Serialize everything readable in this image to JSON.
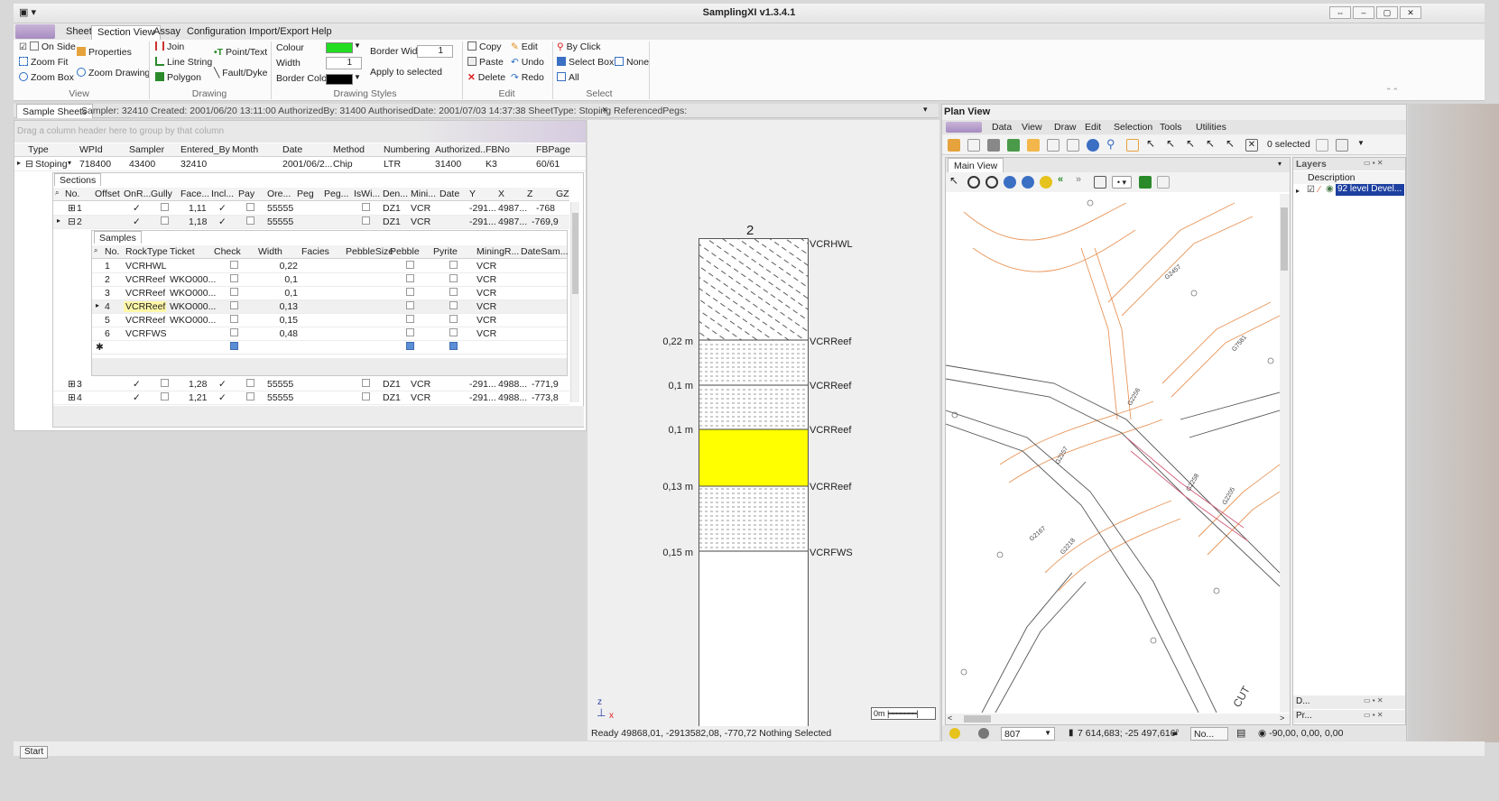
{
  "app": {
    "title": "SamplingXI v1.3.4.1",
    "quick_access": "▾"
  },
  "ribbon": {
    "tabs": [
      "Sheet",
      "Section View",
      "Assay",
      "Configuration",
      "Import/Export",
      "Help"
    ],
    "active_tab": "Section View",
    "view": {
      "group": "View",
      "on_side": "On Side",
      "zoom_fit": "Zoom Fit",
      "zoom_box": "Zoom Box",
      "properties": "Properties",
      "zoom_drawing": "Zoom Drawing"
    },
    "drawing": {
      "group": "Drawing",
      "join": "Join",
      "line_string": "Line String",
      "polygon": "Polygon",
      "point_text": "Point/Text",
      "fault_dyke": "Fault/Dyke"
    },
    "drawing_styles": {
      "group": "Drawing Styles",
      "colour_label": "Colour",
      "width_label": "Width",
      "width_value": "1",
      "border_colour_label": "Border Colour",
      "border_width_label": "Border Width",
      "border_width_value": "1",
      "apply": "Apply to selected",
      "colour_hex": "#22dd22",
      "border_colour_hex": "#000000"
    },
    "edit": {
      "group": "Edit",
      "copy": "Copy",
      "paste": "Paste",
      "delete": "Delete",
      "edit": "Edit",
      "undo": "Undo",
      "redo": "Redo"
    },
    "select": {
      "group": "Select",
      "by_click": "By Click",
      "select_box": "Select Box",
      "all": "All",
      "none": "None"
    }
  },
  "doc_tab": {
    "label": "Sample Sheets",
    "info": "Sampler: 32410 Created: 2001/06/20 13:11:00 AuthorizedBy: 31400 AuthorisedDate: 2001/07/03 14:37:38 SheetType: Stoping ReferencedPegs:",
    "close": "×"
  },
  "grid": {
    "group_hint": "Drag a column header here to group by that column",
    "columns": [
      "Type",
      "WPId",
      "Sampler",
      "Entered_By",
      "Month",
      "Date",
      "Method",
      "Numbering",
      "Authorized...",
      "FBNo",
      "FBPage"
    ],
    "row": [
      "Stoping",
      "718400",
      "43400",
      "32410",
      "",
      "2001/06/2...",
      "Chip",
      "LTR",
      "31400",
      "K3",
      "60/61"
    ],
    "sections": {
      "tab": "Sections",
      "columns": [
        "No.",
        "Offset",
        "OnR...",
        "Gully",
        "Face...",
        "Incl...",
        "Pay",
        "Ore...",
        "Peg",
        "Peg...",
        "IsWi...",
        "Den...",
        "Mini...",
        "Date",
        "Y",
        "X",
        "Z",
        "GZ"
      ],
      "rows": [
        {
          "no": "1",
          "face": "1,11",
          "ore": "55555",
          "den": "DZ1",
          "mini": "VCR",
          "y": "-291...",
          "x": "4987...",
          "z": "-768"
        },
        {
          "no": "2",
          "face": "1,18",
          "ore": "55555",
          "den": "DZ1",
          "mini": "VCR",
          "y": "-291...",
          "x": "4987...",
          "z": "-769,9"
        },
        {
          "no": "3",
          "face": "1,28",
          "ore": "55555",
          "den": "DZ1",
          "mini": "VCR",
          "y": "-291...",
          "x": "4988...",
          "z": "-771,9"
        },
        {
          "no": "4",
          "face": "1,21",
          "ore": "55555",
          "den": "DZ1",
          "mini": "VCR",
          "y": "-291...",
          "x": "4988...",
          "z": "-773,8"
        }
      ]
    },
    "samples": {
      "tab": "Samples",
      "columns": [
        "No.",
        "RockType",
        "Ticket",
        "Check",
        "Width",
        "Facies",
        "PebbleSize",
        "Pebble",
        "Pyrite",
        "MiningR...",
        "DateSam..."
      ],
      "rows": [
        {
          "no": "1",
          "rock": "VCRHWL",
          "ticket": "",
          "width": "0,22",
          "mining": "VCR"
        },
        {
          "no": "2",
          "rock": "VCRReef",
          "ticket": "WKO000...",
          "width": "0,1",
          "mining": "VCR"
        },
        {
          "no": "3",
          "rock": "VCRReef",
          "ticket": "WKO000...",
          "width": "0,1",
          "mining": "VCR"
        },
        {
          "no": "4",
          "rock": "VCRReef",
          "ticket": "WKO000...",
          "width": "0,13",
          "mining": "VCR"
        },
        {
          "no": "5",
          "rock": "VCRReef",
          "ticket": "WKO000...",
          "width": "0,15",
          "mining": "VCR"
        },
        {
          "no": "6",
          "rock": "VCRFWS",
          "ticket": "",
          "width": "0,48",
          "mining": "VCR"
        }
      ]
    }
  },
  "section_view": {
    "section_number": "2",
    "layers": [
      {
        "width_label": "",
        "rock": "VCRHWL"
      },
      {
        "width_label": "0,22 m",
        "rock": "VCRReef"
      },
      {
        "width_label": "0,1 m",
        "rock": "VCRReef"
      },
      {
        "width_label": "0,1 m",
        "rock": "VCRReef"
      },
      {
        "width_label": "0,13 m",
        "rock": "VCRReef"
      },
      {
        "width_label": "0,15 m",
        "rock": "VCRFWS"
      }
    ],
    "highlight_colour": "#ffff00",
    "scale_label": "0m",
    "axis_z": "z",
    "axis_x": "x",
    "status": "Ready  49868,01, -2913582,08, -770,72  Nothing Selected"
  },
  "plan_view": {
    "title": "Plan View",
    "menu": [
      "Data",
      "View",
      "Draw",
      "Edit",
      "Selection",
      "Tools",
      "Utilities"
    ],
    "selected_count": "0 selected",
    "main_view_tab": "Main View",
    "layers_title": "Layers",
    "layers_column": "Description",
    "layer_item": "92 level Devel...",
    "dock_d": "D...",
    "dock_pr": "Pr...",
    "status_zoom": "807",
    "status_coords": "7 614,683; -25 497,616",
    "status_no": "No...",
    "status_rotation": "-90,00, 0,00, 0,00",
    "map_labels": [
      "G2457",
      "G2256",
      "G2257",
      "G2167",
      "G2258",
      "G2205",
      "G2218",
      "G7581",
      "CUT"
    ]
  },
  "start_button": "Start"
}
